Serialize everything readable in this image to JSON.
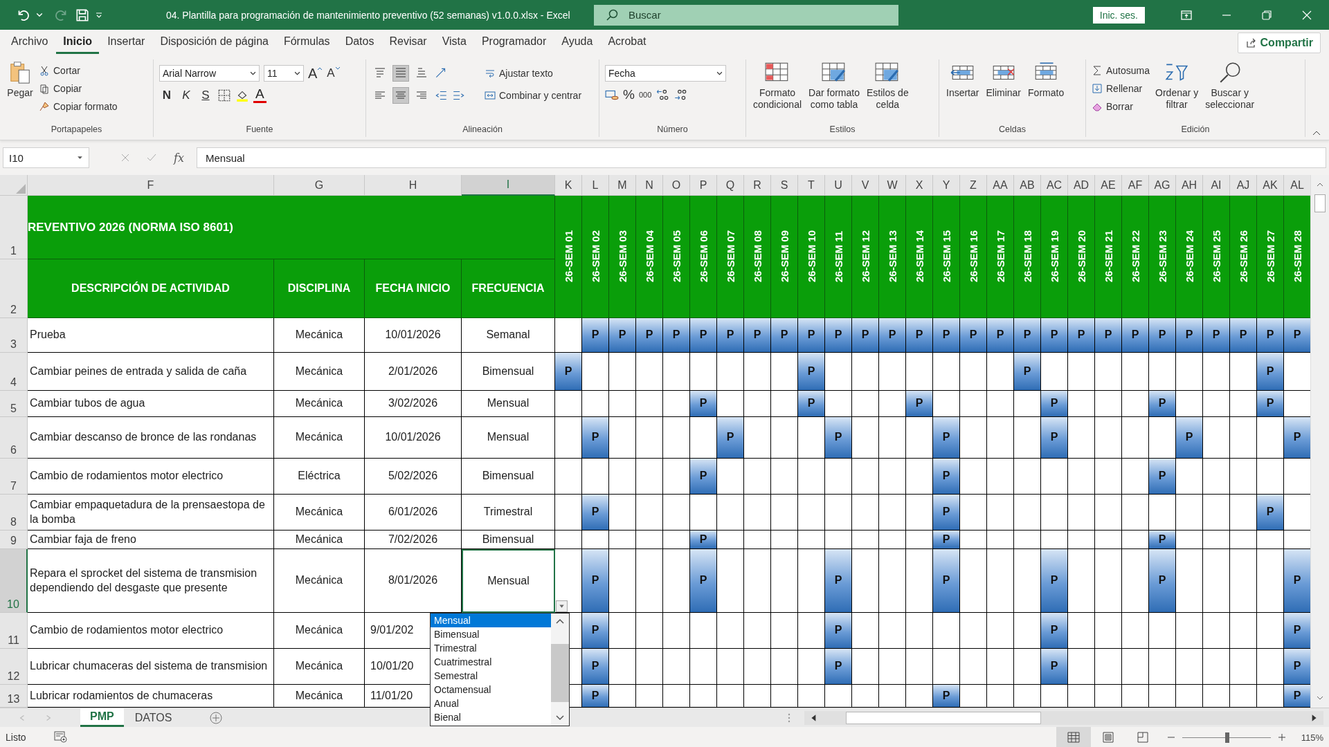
{
  "title_bar": {
    "title": "04. Plantilla para programación de mantenimiento preventivo (52 semanas) v1.0.0.xlsx  -  Excel",
    "search_placeholder": "Buscar",
    "sign_in": "Inic. ses."
  },
  "menu_tabs": [
    {
      "label": "Archivo",
      "selected": false
    },
    {
      "label": "Inicio",
      "selected": true
    },
    {
      "label": "Insertar",
      "selected": false
    },
    {
      "label": "Disposición de página",
      "selected": false
    },
    {
      "label": "Fórmulas",
      "selected": false
    },
    {
      "label": "Datos",
      "selected": false
    },
    {
      "label": "Revisar",
      "selected": false
    },
    {
      "label": "Vista",
      "selected": false
    },
    {
      "label": "Programador",
      "selected": false
    },
    {
      "label": "Ayuda",
      "selected": false
    },
    {
      "label": "Acrobat",
      "selected": false
    }
  ],
  "share_button": "Compartir",
  "ribbon": {
    "clipboard": {
      "group": "Portapapeles",
      "paste": "Pegar",
      "items": [
        "Cortar",
        "Copiar",
        "Copiar formato"
      ]
    },
    "font": {
      "group": "Fuente",
      "font_name": "Arial Narrow",
      "font_size": "11",
      "grow": "A",
      "shrink": "A",
      "styles": [
        "N",
        "K",
        "S"
      ],
      "color_letter": "A"
    },
    "alignment": {
      "group": "Alineación",
      "valign": [
        {
          "kind": "top",
          "selected": false
        },
        {
          "kind": "middle",
          "selected": true
        },
        {
          "kind": "bottom",
          "selected": false
        }
      ],
      "halign": [
        {
          "kind": "left",
          "selected": false
        },
        {
          "kind": "center",
          "selected": true
        },
        {
          "kind": "right",
          "selected": false
        }
      ],
      "wrap": "Ajustar texto",
      "merge": "Combinar y centrar"
    },
    "number": {
      "group": "Número",
      "format": "Fecha",
      "percent": "%",
      "thousands": "000"
    },
    "styles": {
      "group": "Estilos",
      "buttons": [
        "Formato\ncondicional",
        "Dar formato\ncomo tabla",
        "Estilos de\ncelda"
      ]
    },
    "cells": {
      "group": "Celdas",
      "buttons": [
        "Insertar",
        "Eliminar",
        "Formato"
      ]
    },
    "editing": {
      "group": "Edición",
      "items": [
        "Autosuma",
        "Rellenar",
        "Borrar"
      ],
      "buttons": [
        "Ordenar y\nfiltrar",
        "Buscar y\nseleccionar"
      ]
    }
  },
  "formula_bar": {
    "name_box": "I10",
    "fx": "fx",
    "value": "Mensual"
  },
  "sheet": {
    "columns": [
      {
        "label": "F",
        "selected": false
      },
      {
        "label": "G",
        "selected": false
      },
      {
        "label": "H",
        "selected": false
      },
      {
        "label": "I",
        "selected": true
      },
      {
        "label": "K",
        "selected": false
      },
      {
        "label": "L",
        "selected": false
      },
      {
        "label": "M",
        "selected": false
      },
      {
        "label": "N",
        "selected": false
      },
      {
        "label": "O",
        "selected": false
      },
      {
        "label": "P",
        "selected": false
      },
      {
        "label": "Q",
        "selected": false
      },
      {
        "label": "R",
        "selected": false
      },
      {
        "label": "S",
        "selected": false
      },
      {
        "label": "T",
        "selected": false
      },
      {
        "label": "U",
        "selected": false
      },
      {
        "label": "V",
        "selected": false
      },
      {
        "label": "W",
        "selected": false
      },
      {
        "label": "X",
        "selected": false
      },
      {
        "label": "Y",
        "selected": false
      },
      {
        "label": "Z",
        "selected": false
      },
      {
        "label": "AA",
        "selected": false
      },
      {
        "label": "AB",
        "selected": false
      },
      {
        "label": "AC",
        "selected": false
      },
      {
        "label": "AD",
        "selected": false
      },
      {
        "label": "AE",
        "selected": false
      },
      {
        "label": "AF",
        "selected": false
      },
      {
        "label": "AG",
        "selected": false
      },
      {
        "label": "AH",
        "selected": false
      },
      {
        "label": "AI",
        "selected": false
      },
      {
        "label": "AJ",
        "selected": false
      },
      {
        "label": "AK",
        "selected": false
      },
      {
        "label": "AL",
        "selected": false
      }
    ],
    "title": {
      "row": "1",
      "text": "REVENTIVO 2026 (NORMA ISO 8601)"
    },
    "header": {
      "row": "2",
      "labels": [
        "DESCRIPCIÓN DE ACTIVIDAD",
        "DISCIPLINA",
        "FECHA INICIO",
        "FRECUENCIA"
      ]
    },
    "week_headers": [
      "26-SEM 01",
      "26-SEM 02",
      "26-SEM 03",
      "26-SEM 04",
      "26-SEM 05",
      "26-SEM 06",
      "26-SEM 07",
      "26-SEM 08",
      "26-SEM 09",
      "26-SEM 10",
      "26-SEM 11",
      "26-SEM 12",
      "26-SEM 13",
      "26-SEM 14",
      "26-SEM 15",
      "26-SEM 16",
      "26-SEM 17",
      "26-SEM 18",
      "26-SEM 19",
      "26-SEM 20",
      "26-SEM 21",
      "26-SEM 22",
      "26-SEM 23",
      "26-SEM 24",
      "26-SEM 25",
      "26-SEM 26",
      "26-SEM 27",
      "26-SEM 28"
    ],
    "rows": [
      {
        "row": "3",
        "description": "Prueba",
        "discipline": "Mecánica",
        "start": "10/01/2026",
        "frequency": "Semanal",
        "selected": false,
        "weeks": [
          {
            "planned": false
          },
          {
            "planned": true,
            "mark": "P"
          },
          {
            "planned": true,
            "mark": "P"
          },
          {
            "planned": true,
            "mark": "P"
          },
          {
            "planned": true,
            "mark": "P"
          },
          {
            "planned": true,
            "mark": "P"
          },
          {
            "planned": true,
            "mark": "P"
          },
          {
            "planned": true,
            "mark": "P"
          },
          {
            "planned": true,
            "mark": "P"
          },
          {
            "planned": true,
            "mark": "P"
          },
          {
            "planned": true,
            "mark": "P"
          },
          {
            "planned": true,
            "mark": "P"
          },
          {
            "planned": true,
            "mark": "P"
          },
          {
            "planned": true,
            "mark": "P"
          },
          {
            "planned": true,
            "mark": "P"
          },
          {
            "planned": true,
            "mark": "P"
          },
          {
            "planned": true,
            "mark": "P"
          },
          {
            "planned": true,
            "mark": "P"
          },
          {
            "planned": true,
            "mark": "P"
          },
          {
            "planned": true,
            "mark": "P"
          },
          {
            "planned": true,
            "mark": "P"
          },
          {
            "planned": true,
            "mark": "P"
          },
          {
            "planned": true,
            "mark": "P"
          },
          {
            "planned": true,
            "mark": "P"
          },
          {
            "planned": true,
            "mark": "P"
          },
          {
            "planned": true,
            "mark": "P"
          },
          {
            "planned": true,
            "mark": "P"
          },
          {
            "planned": true,
            "mark": "P"
          }
        ]
      },
      {
        "row": "4",
        "description": "Cambiar peines de entrada y salida de caña",
        "discipline": "Mecánica",
        "start": "2/01/2026",
        "frequency": "Bimensual",
        "selected": false,
        "weeks": [
          {
            "planned": true,
            "mark": "P"
          },
          {
            "planned": false
          },
          {
            "planned": false
          },
          {
            "planned": false
          },
          {
            "planned": false
          },
          {
            "planned": false
          },
          {
            "planned": false
          },
          {
            "planned": false
          },
          {
            "planned": false
          },
          {
            "planned": true,
            "mark": "P"
          },
          {
            "planned": false
          },
          {
            "planned": false
          },
          {
            "planned": false
          },
          {
            "planned": false
          },
          {
            "planned": false
          },
          {
            "planned": false
          },
          {
            "planned": false
          },
          {
            "planned": true,
            "mark": "P"
          },
          {
            "planned": false
          },
          {
            "planned": false
          },
          {
            "planned": false
          },
          {
            "planned": false
          },
          {
            "planned": false
          },
          {
            "planned": false
          },
          {
            "planned": false
          },
          {
            "planned": false
          },
          {
            "planned": true,
            "mark": "P"
          },
          {
            "planned": false
          }
        ]
      },
      {
        "row": "5",
        "description": "Cambiar tubos de agua",
        "discipline": "Mecánica",
        "start": "3/02/2026",
        "frequency": "Mensual",
        "selected": false,
        "weeks": [
          {
            "planned": false
          },
          {
            "planned": false
          },
          {
            "planned": false
          },
          {
            "planned": false
          },
          {
            "planned": false
          },
          {
            "planned": true,
            "mark": "P"
          },
          {
            "planned": false
          },
          {
            "planned": false
          },
          {
            "planned": false
          },
          {
            "planned": true,
            "mark": "P"
          },
          {
            "planned": false
          },
          {
            "planned": false
          },
          {
            "planned": false
          },
          {
            "planned": true,
            "mark": "P"
          },
          {
            "planned": false
          },
          {
            "planned": false
          },
          {
            "planned": false
          },
          {
            "planned": false
          },
          {
            "planned": true,
            "mark": "P"
          },
          {
            "planned": false
          },
          {
            "planned": false
          },
          {
            "planned": false
          },
          {
            "planned": true,
            "mark": "P"
          },
          {
            "planned": false
          },
          {
            "planned": false
          },
          {
            "planned": false
          },
          {
            "planned": true,
            "mark": "P"
          },
          {
            "planned": false
          }
        ]
      },
      {
        "row": "6",
        "description": "Cambiar descanso de bronce de las rondanas",
        "discipline": "Mecánica",
        "start": "10/01/2026",
        "frequency": "Mensual",
        "selected": false,
        "weeks": [
          {
            "planned": false
          },
          {
            "planned": true,
            "mark": "P"
          },
          {
            "planned": false
          },
          {
            "planned": false
          },
          {
            "planned": false
          },
          {
            "planned": false
          },
          {
            "planned": true,
            "mark": "P"
          },
          {
            "planned": false
          },
          {
            "planned": false
          },
          {
            "planned": false
          },
          {
            "planned": true,
            "mark": "P"
          },
          {
            "planned": false
          },
          {
            "planned": false
          },
          {
            "planned": false
          },
          {
            "planned": true,
            "mark": "P"
          },
          {
            "planned": false
          },
          {
            "planned": false
          },
          {
            "planned": false
          },
          {
            "planned": true,
            "mark": "P"
          },
          {
            "planned": false
          },
          {
            "planned": false
          },
          {
            "planned": false
          },
          {
            "planned": false
          },
          {
            "planned": true,
            "mark": "P"
          },
          {
            "planned": false
          },
          {
            "planned": false
          },
          {
            "planned": false
          },
          {
            "planned": true,
            "mark": "P"
          }
        ]
      },
      {
        "row": "7",
        "description": "Cambio de rodamientos motor electrico",
        "discipline": "Eléctrica",
        "start": "5/02/2026",
        "frequency": "Bimensual",
        "selected": false,
        "weeks": [
          {
            "planned": false
          },
          {
            "planned": false
          },
          {
            "planned": false
          },
          {
            "planned": false
          },
          {
            "planned": false
          },
          {
            "planned": true,
            "mark": "P"
          },
          {
            "planned": false
          },
          {
            "planned": false
          },
          {
            "planned": false
          },
          {
            "planned": false
          },
          {
            "planned": false
          },
          {
            "planned": false
          },
          {
            "planned": false
          },
          {
            "planned": false
          },
          {
            "planned": true,
            "mark": "P"
          },
          {
            "planned": false
          },
          {
            "planned": false
          },
          {
            "planned": false
          },
          {
            "planned": false
          },
          {
            "planned": false
          },
          {
            "planned": false
          },
          {
            "planned": false
          },
          {
            "planned": true,
            "mark": "P"
          },
          {
            "planned": false
          },
          {
            "planned": false
          },
          {
            "planned": false
          },
          {
            "planned": false
          },
          {
            "planned": false
          }
        ]
      },
      {
        "row": "8",
        "description": "Cambiar empaquetadura de la prensaestopa de la bomba",
        "discipline": "Mecánica",
        "start": "6/01/2026",
        "frequency": "Trimestral",
        "selected": false,
        "weeks": [
          {
            "planned": false
          },
          {
            "planned": true,
            "mark": "P"
          },
          {
            "planned": false
          },
          {
            "planned": false
          },
          {
            "planned": false
          },
          {
            "planned": false
          },
          {
            "planned": false
          },
          {
            "planned": false
          },
          {
            "planned": false
          },
          {
            "planned": false
          },
          {
            "planned": false
          },
          {
            "planned": false
          },
          {
            "planned": false
          },
          {
            "planned": false
          },
          {
            "planned": true,
            "mark": "P"
          },
          {
            "planned": false
          },
          {
            "planned": false
          },
          {
            "planned": false
          },
          {
            "planned": false
          },
          {
            "planned": false
          },
          {
            "planned": false
          },
          {
            "planned": false
          },
          {
            "planned": false
          },
          {
            "planned": false
          },
          {
            "planned": false
          },
          {
            "planned": false
          },
          {
            "planned": true,
            "mark": "P"
          },
          {
            "planned": false
          }
        ]
      },
      {
        "row": "9",
        "description": "Cambiar faja de freno",
        "discipline": "Mecánica",
        "start": "7/02/2026",
        "frequency": "Bimensual",
        "selected": false,
        "weeks": [
          {
            "planned": false
          },
          {
            "planned": false
          },
          {
            "planned": false
          },
          {
            "planned": false
          },
          {
            "planned": false
          },
          {
            "planned": true,
            "mark": "P"
          },
          {
            "planned": false
          },
          {
            "planned": false
          },
          {
            "planned": false
          },
          {
            "planned": false
          },
          {
            "planned": false
          },
          {
            "planned": false
          },
          {
            "planned": false
          },
          {
            "planned": false
          },
          {
            "planned": true,
            "mark": "P"
          },
          {
            "planned": false
          },
          {
            "planned": false
          },
          {
            "planned": false
          },
          {
            "planned": false
          },
          {
            "planned": false
          },
          {
            "planned": false
          },
          {
            "planned": false
          },
          {
            "planned": true,
            "mark": "P"
          },
          {
            "planned": false
          },
          {
            "planned": false
          },
          {
            "planned": false
          },
          {
            "planned": false
          },
          {
            "planned": false
          }
        ]
      },
      {
        "row": "10",
        "description": "Repara el sprocket del sistema de transmision dependiendo del desgaste que presente",
        "discipline": "Mecánica",
        "start": "8/01/2026",
        "frequency": "Mensual",
        "selected": true,
        "weeks": [
          {
            "planned": false
          },
          {
            "planned": true,
            "mark": "P"
          },
          {
            "planned": false
          },
          {
            "planned": false
          },
          {
            "planned": false
          },
          {
            "planned": true,
            "mark": "P"
          },
          {
            "planned": false
          },
          {
            "planned": false
          },
          {
            "planned": false
          },
          {
            "planned": false
          },
          {
            "planned": true,
            "mark": "P"
          },
          {
            "planned": false
          },
          {
            "planned": false
          },
          {
            "planned": false
          },
          {
            "planned": true,
            "mark": "P"
          },
          {
            "planned": false
          },
          {
            "planned": false
          },
          {
            "planned": false
          },
          {
            "planned": true,
            "mark": "P"
          },
          {
            "planned": false
          },
          {
            "planned": false
          },
          {
            "planned": false
          },
          {
            "planned": true,
            "mark": "P"
          },
          {
            "planned": false
          },
          {
            "planned": false
          },
          {
            "planned": false
          },
          {
            "planned": false
          },
          {
            "planned": true,
            "mark": "P"
          }
        ]
      },
      {
        "row": "11",
        "description": "Cambio de rodamientos motor electrico",
        "discipline": "Mecánica",
        "start": "9/01/202",
        "selected": false,
        "weeks": [
          {
            "planned": false
          },
          {
            "planned": true,
            "mark": "P"
          },
          {
            "planned": false
          },
          {
            "planned": false
          },
          {
            "planned": false
          },
          {
            "planned": false
          },
          {
            "planned": false
          },
          {
            "planned": false
          },
          {
            "planned": false
          },
          {
            "planned": false
          },
          {
            "planned": true,
            "mark": "P"
          },
          {
            "planned": false
          },
          {
            "planned": false
          },
          {
            "planned": false
          },
          {
            "planned": false
          },
          {
            "planned": false
          },
          {
            "planned": false
          },
          {
            "planned": false
          },
          {
            "planned": true,
            "mark": "P"
          },
          {
            "planned": false
          },
          {
            "planned": false
          },
          {
            "planned": false
          },
          {
            "planned": false
          },
          {
            "planned": false
          },
          {
            "planned": false
          },
          {
            "planned": false
          },
          {
            "planned": false
          },
          {
            "planned": true,
            "mark": "P"
          }
        ]
      },
      {
        "row": "12",
        "description": "Lubricar chumaceras del sistema de transmision",
        "discipline": "Mecánica",
        "start": "10/01/20",
        "selected": false,
        "weeks": [
          {
            "planned": false
          },
          {
            "planned": true,
            "mark": "P"
          },
          {
            "planned": false
          },
          {
            "planned": false
          },
          {
            "planned": false
          },
          {
            "planned": false
          },
          {
            "planned": false
          },
          {
            "planned": false
          },
          {
            "planned": false
          },
          {
            "planned": false
          },
          {
            "planned": true,
            "mark": "P"
          },
          {
            "planned": false
          },
          {
            "planned": false
          },
          {
            "planned": false
          },
          {
            "planned": false
          },
          {
            "planned": false
          },
          {
            "planned": false
          },
          {
            "planned": false
          },
          {
            "planned": true,
            "mark": "P"
          },
          {
            "planned": false
          },
          {
            "planned": false
          },
          {
            "planned": false
          },
          {
            "planned": false
          },
          {
            "planned": false
          },
          {
            "planned": false
          },
          {
            "planned": false
          },
          {
            "planned": false
          },
          {
            "planned": true,
            "mark": "P"
          }
        ]
      },
      {
        "row": "13",
        "description": "Lubricar rodamientos de chumaceras",
        "discipline": "Mecánica",
        "start": "11/01/20",
        "selected": false,
        "weeks": [
          {
            "planned": false
          },
          {
            "planned": true,
            "mark": "P"
          },
          {
            "planned": false
          },
          {
            "planned": false
          },
          {
            "planned": false
          },
          {
            "planned": false
          },
          {
            "planned": false
          },
          {
            "planned": false
          },
          {
            "planned": false
          },
          {
            "planned": false
          },
          {
            "planned": false
          },
          {
            "planned": false
          },
          {
            "planned": false
          },
          {
            "planned": false
          },
          {
            "planned": true,
            "mark": "P"
          },
          {
            "planned": false
          },
          {
            "planned": false
          },
          {
            "planned": false
          },
          {
            "planned": false
          },
          {
            "planned": false
          },
          {
            "planned": false
          },
          {
            "planned": false
          },
          {
            "planned": false
          },
          {
            "planned": false
          },
          {
            "planned": false
          },
          {
            "planned": false
          },
          {
            "planned": false
          },
          {
            "planned": true,
            "mark": "P"
          }
        ]
      }
    ],
    "dropdown": [
      {
        "label": "Mensual",
        "selected": true
      },
      {
        "label": "Bimensual",
        "selected": false
      },
      {
        "label": "Trimestral",
        "selected": false
      },
      {
        "label": "Cuatrimestral",
        "selected": false
      },
      {
        "label": "Semestral",
        "selected": false
      },
      {
        "label": "Octamensual",
        "selected": false
      },
      {
        "label": "Anual",
        "selected": false
      },
      {
        "label": "Bienal",
        "selected": false
      }
    ]
  },
  "sheet_tabs": [
    {
      "label": "PMP",
      "selected": true
    },
    {
      "label": "DATOS",
      "selected": false
    }
  ],
  "status_bar": {
    "status": "Listo",
    "views": [
      {
        "kind": "normal",
        "selected": true
      },
      {
        "kind": "page",
        "selected": false
      },
      {
        "kind": "break",
        "selected": false
      }
    ],
    "zoom": {
      "label": "115%",
      "level": 0.51
    }
  }
}
